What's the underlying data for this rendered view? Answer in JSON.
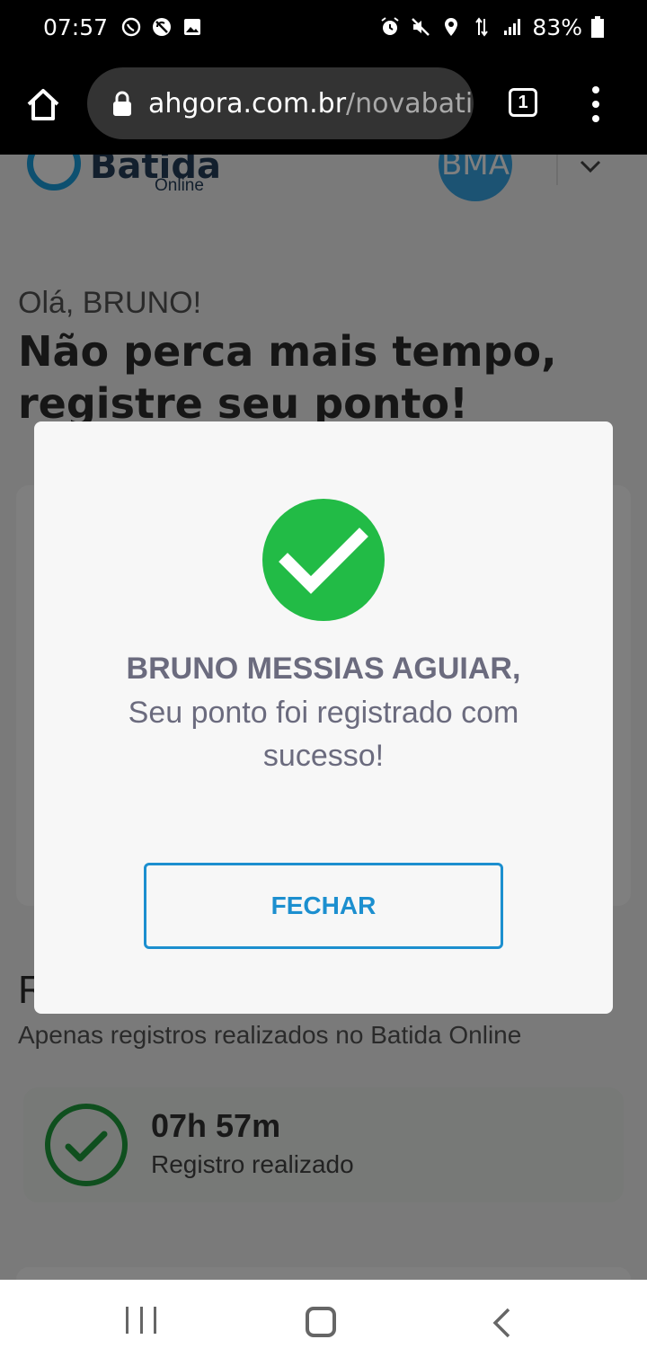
{
  "status_bar": {
    "time": "07:57",
    "icons_left": [
      "whatsapp-icon",
      "sync-off-icon",
      "gallery-icon"
    ],
    "icons_right": [
      "alarm-icon",
      "mute-icon",
      "location-icon",
      "data-icon",
      "signal-icon"
    ],
    "battery": "83%"
  },
  "browser": {
    "url_domain": "ahgora.com.br",
    "url_path": "/novabati",
    "tab_count": "1"
  },
  "header": {
    "logo_title": "Batida",
    "logo_subtitle": "Online",
    "avatar_initials": "BMA"
  },
  "main": {
    "greeting": "Olá, BRUNO!",
    "headline": "Não perca mais tempo, registre seu ponto!"
  },
  "records": {
    "title": "R",
    "subtitle": "Apenas registros realizados no Batida Online",
    "items": [
      {
        "time": "07h 57m",
        "label": "Registro realizado"
      }
    ]
  },
  "modal": {
    "name": "BRUNO MESSIAS AGUIAR,",
    "message": "Seu ponto foi registrado com sucesso!",
    "close_label": "FECHAR",
    "success_color": "#22bb46",
    "accent_color": "#1c8fcf"
  }
}
